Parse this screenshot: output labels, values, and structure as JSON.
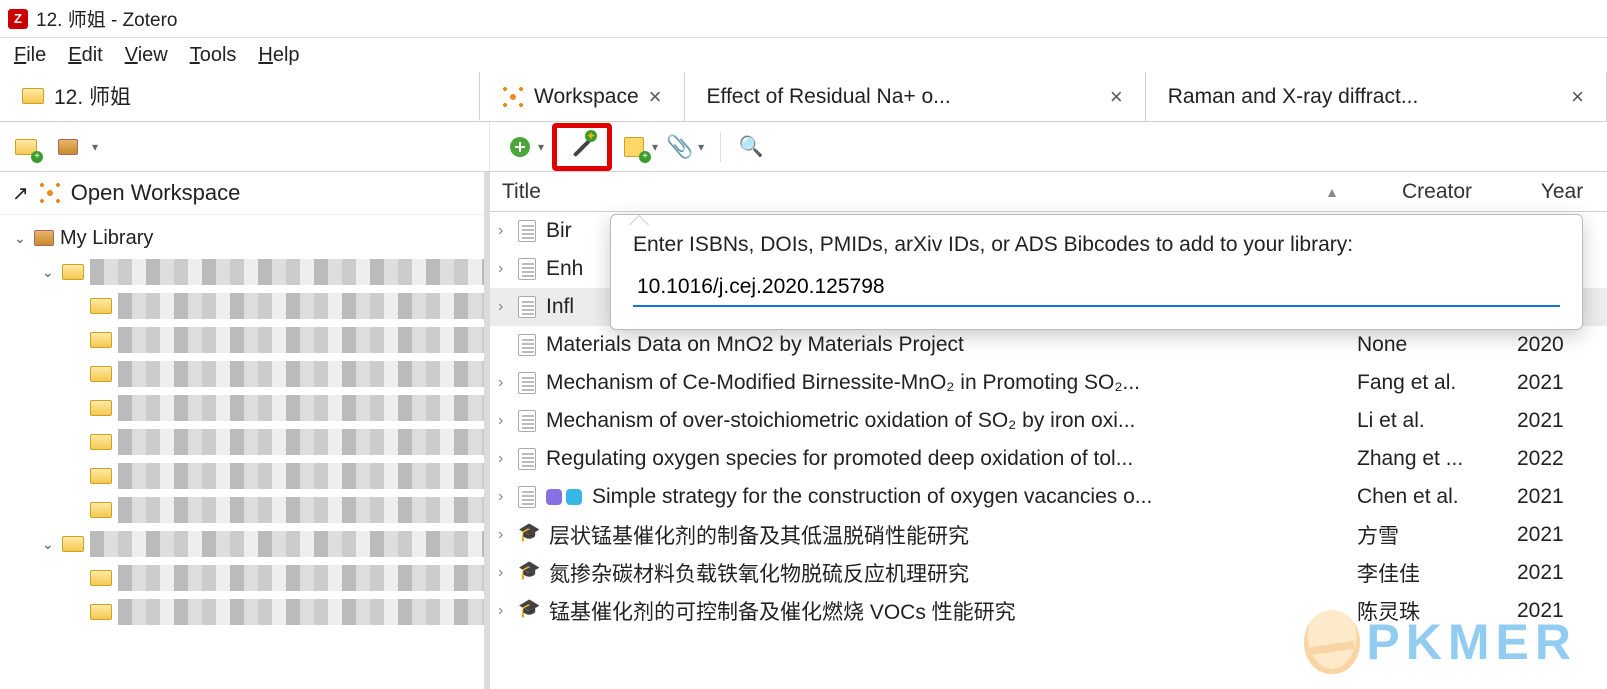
{
  "window": {
    "title": "12. 师姐 - Zotero",
    "app_badge": "Z"
  },
  "menu": {
    "file": "File",
    "edit": "Edit",
    "view": "View",
    "tools": "Tools",
    "help": "Help"
  },
  "tabs": [
    {
      "label": "12. 师姐",
      "icon": "folder",
      "closable": false
    },
    {
      "label": "Workspace",
      "icon": "network",
      "closable": true
    },
    {
      "label": "Effect of Residual Na+ o...",
      "icon": "",
      "closable": true
    },
    {
      "label": "Raman and X-ray diffract...",
      "icon": "",
      "closable": true
    }
  ],
  "sidebar": {
    "open_ws": "Open Workspace",
    "root": "My Library"
  },
  "columns": {
    "title": "Title",
    "creator": "Creator",
    "year": "Year"
  },
  "popover": {
    "label": "Enter ISBNs, DOIs, PMIDs, arXiv IDs, or ADS Bibcodes to add to your library:",
    "value": "10.1016/j.cej.2020.125798"
  },
  "items": [
    {
      "expand": true,
      "icon": "doc",
      "title": "Bir",
      "creator": "",
      "year": ""
    },
    {
      "expand": true,
      "icon": "doc",
      "title": "Enh",
      "creator": "",
      "year": ""
    },
    {
      "expand": true,
      "icon": "doc",
      "title": "Infl",
      "creator": "",
      "year": "",
      "selected": true
    },
    {
      "expand": false,
      "icon": "doc",
      "title": "Materials Data on MnO2 by Materials Project",
      "creator": "None",
      "year": "2020"
    },
    {
      "expand": true,
      "icon": "doc",
      "title": "Mechanism of Ce-Modified Birnessite-MnO₂ in Promoting SO₂...",
      "creator": "Fang et al.",
      "year": "2021"
    },
    {
      "expand": true,
      "icon": "doc",
      "title": "Mechanism of over-stoichiometric oxidation of SO₂ by iron oxi...",
      "creator": "Li et al.",
      "year": "2021"
    },
    {
      "expand": true,
      "icon": "doc",
      "title": "Regulating oxygen species for promoted deep oxidation of tol...",
      "creator": "Zhang et ...",
      "year": "2022"
    },
    {
      "expand": true,
      "icon": "doc",
      "tags": [
        "#8a6fe0",
        "#39b6e8"
      ],
      "title": "Simple strategy for the construction of oxygen vacancies o...",
      "creator": "Chen et al.",
      "year": "2021"
    },
    {
      "expand": true,
      "icon": "thesis",
      "title": "层状锰基催化剂的制备及其低温脱硝性能研究",
      "creator": "方雪",
      "year": "2021"
    },
    {
      "expand": true,
      "icon": "thesis",
      "title": "氮掺杂碳材料负载铁氧化物脱硫反应机理研究",
      "creator": "李佳佳",
      "year": "2021"
    },
    {
      "expand": true,
      "icon": "thesis",
      "title": "锰基催化剂的可控制备及催化燃烧 VOCs 性能研究",
      "creator": "陈灵珠",
      "year": "2021"
    }
  ],
  "watermark": "PKMER"
}
